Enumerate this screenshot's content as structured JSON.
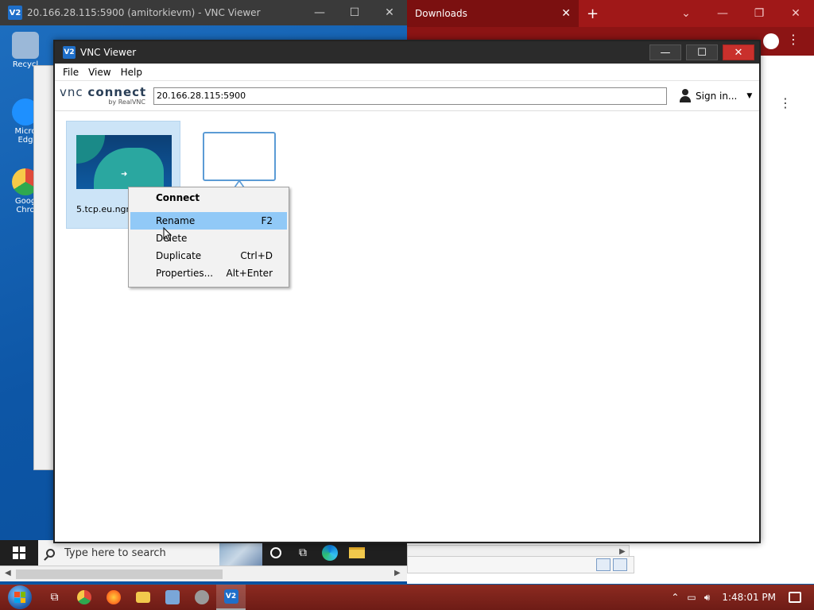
{
  "remote": {
    "window_title": "20.166.28.115:5900 (amitorkievm) - VNC Viewer",
    "app_badge": "V2",
    "desktop_icons": [
      {
        "name": "recycle-bin-icon",
        "label": "Recycl",
        "color": "#9bb8d8"
      },
      {
        "name": "edge-desktop-icon",
        "label": "Micro Edg",
        "color": "#1e90ff"
      },
      {
        "name": "chrome-desktop-icon",
        "label": "Goog Chro",
        "color": "#e04a3a"
      }
    ],
    "taskbar": {
      "search_placeholder": "Type here to search"
    }
  },
  "browser": {
    "tab_title": "Downloads",
    "theme_color": "#a01818"
  },
  "vnc": {
    "title": "VNC Viewer",
    "app_badge": "V2",
    "menu": [
      "File",
      "View",
      "Help"
    ],
    "logo": {
      "line1_a": "vnc",
      "line1_b": "connect",
      "line2": "by RealVNC"
    },
    "address_value": "20.166.28.115:5900",
    "sign_in_label": "Sign in...",
    "connection": {
      "label": "5.tcp.eu.ngrok.io"
    },
    "context_menu": [
      {
        "label": "Connect",
        "shortcut": ""
      },
      {
        "label": "Rename",
        "shortcut": "F2"
      },
      {
        "label": "Delete",
        "shortcut": ""
      },
      {
        "label": "Duplicate",
        "shortcut": "Ctrl+D"
      },
      {
        "label": "Properties...",
        "shortcut": "Alt+Enter"
      }
    ],
    "accent_color": "#91c9f7"
  },
  "host_taskbar": {
    "clock": "1:48:01 PM",
    "apps": [
      {
        "name": "task-view-icon",
        "color": "transparent"
      },
      {
        "name": "chrome-taskbar-icon",
        "color": "#e04a3a"
      },
      {
        "name": "firefox-taskbar-icon",
        "color": "#ff8a1f"
      },
      {
        "name": "explorer-taskbar-icon",
        "color": "#f2c94c"
      },
      {
        "name": "network-app-taskbar-icon",
        "color": "#7aa6d8"
      },
      {
        "name": "tool-taskbar-icon",
        "color": "#9a9a9a"
      },
      {
        "name": "vnc-viewer-taskbar-icon",
        "color": "#1f6fc9"
      }
    ]
  }
}
